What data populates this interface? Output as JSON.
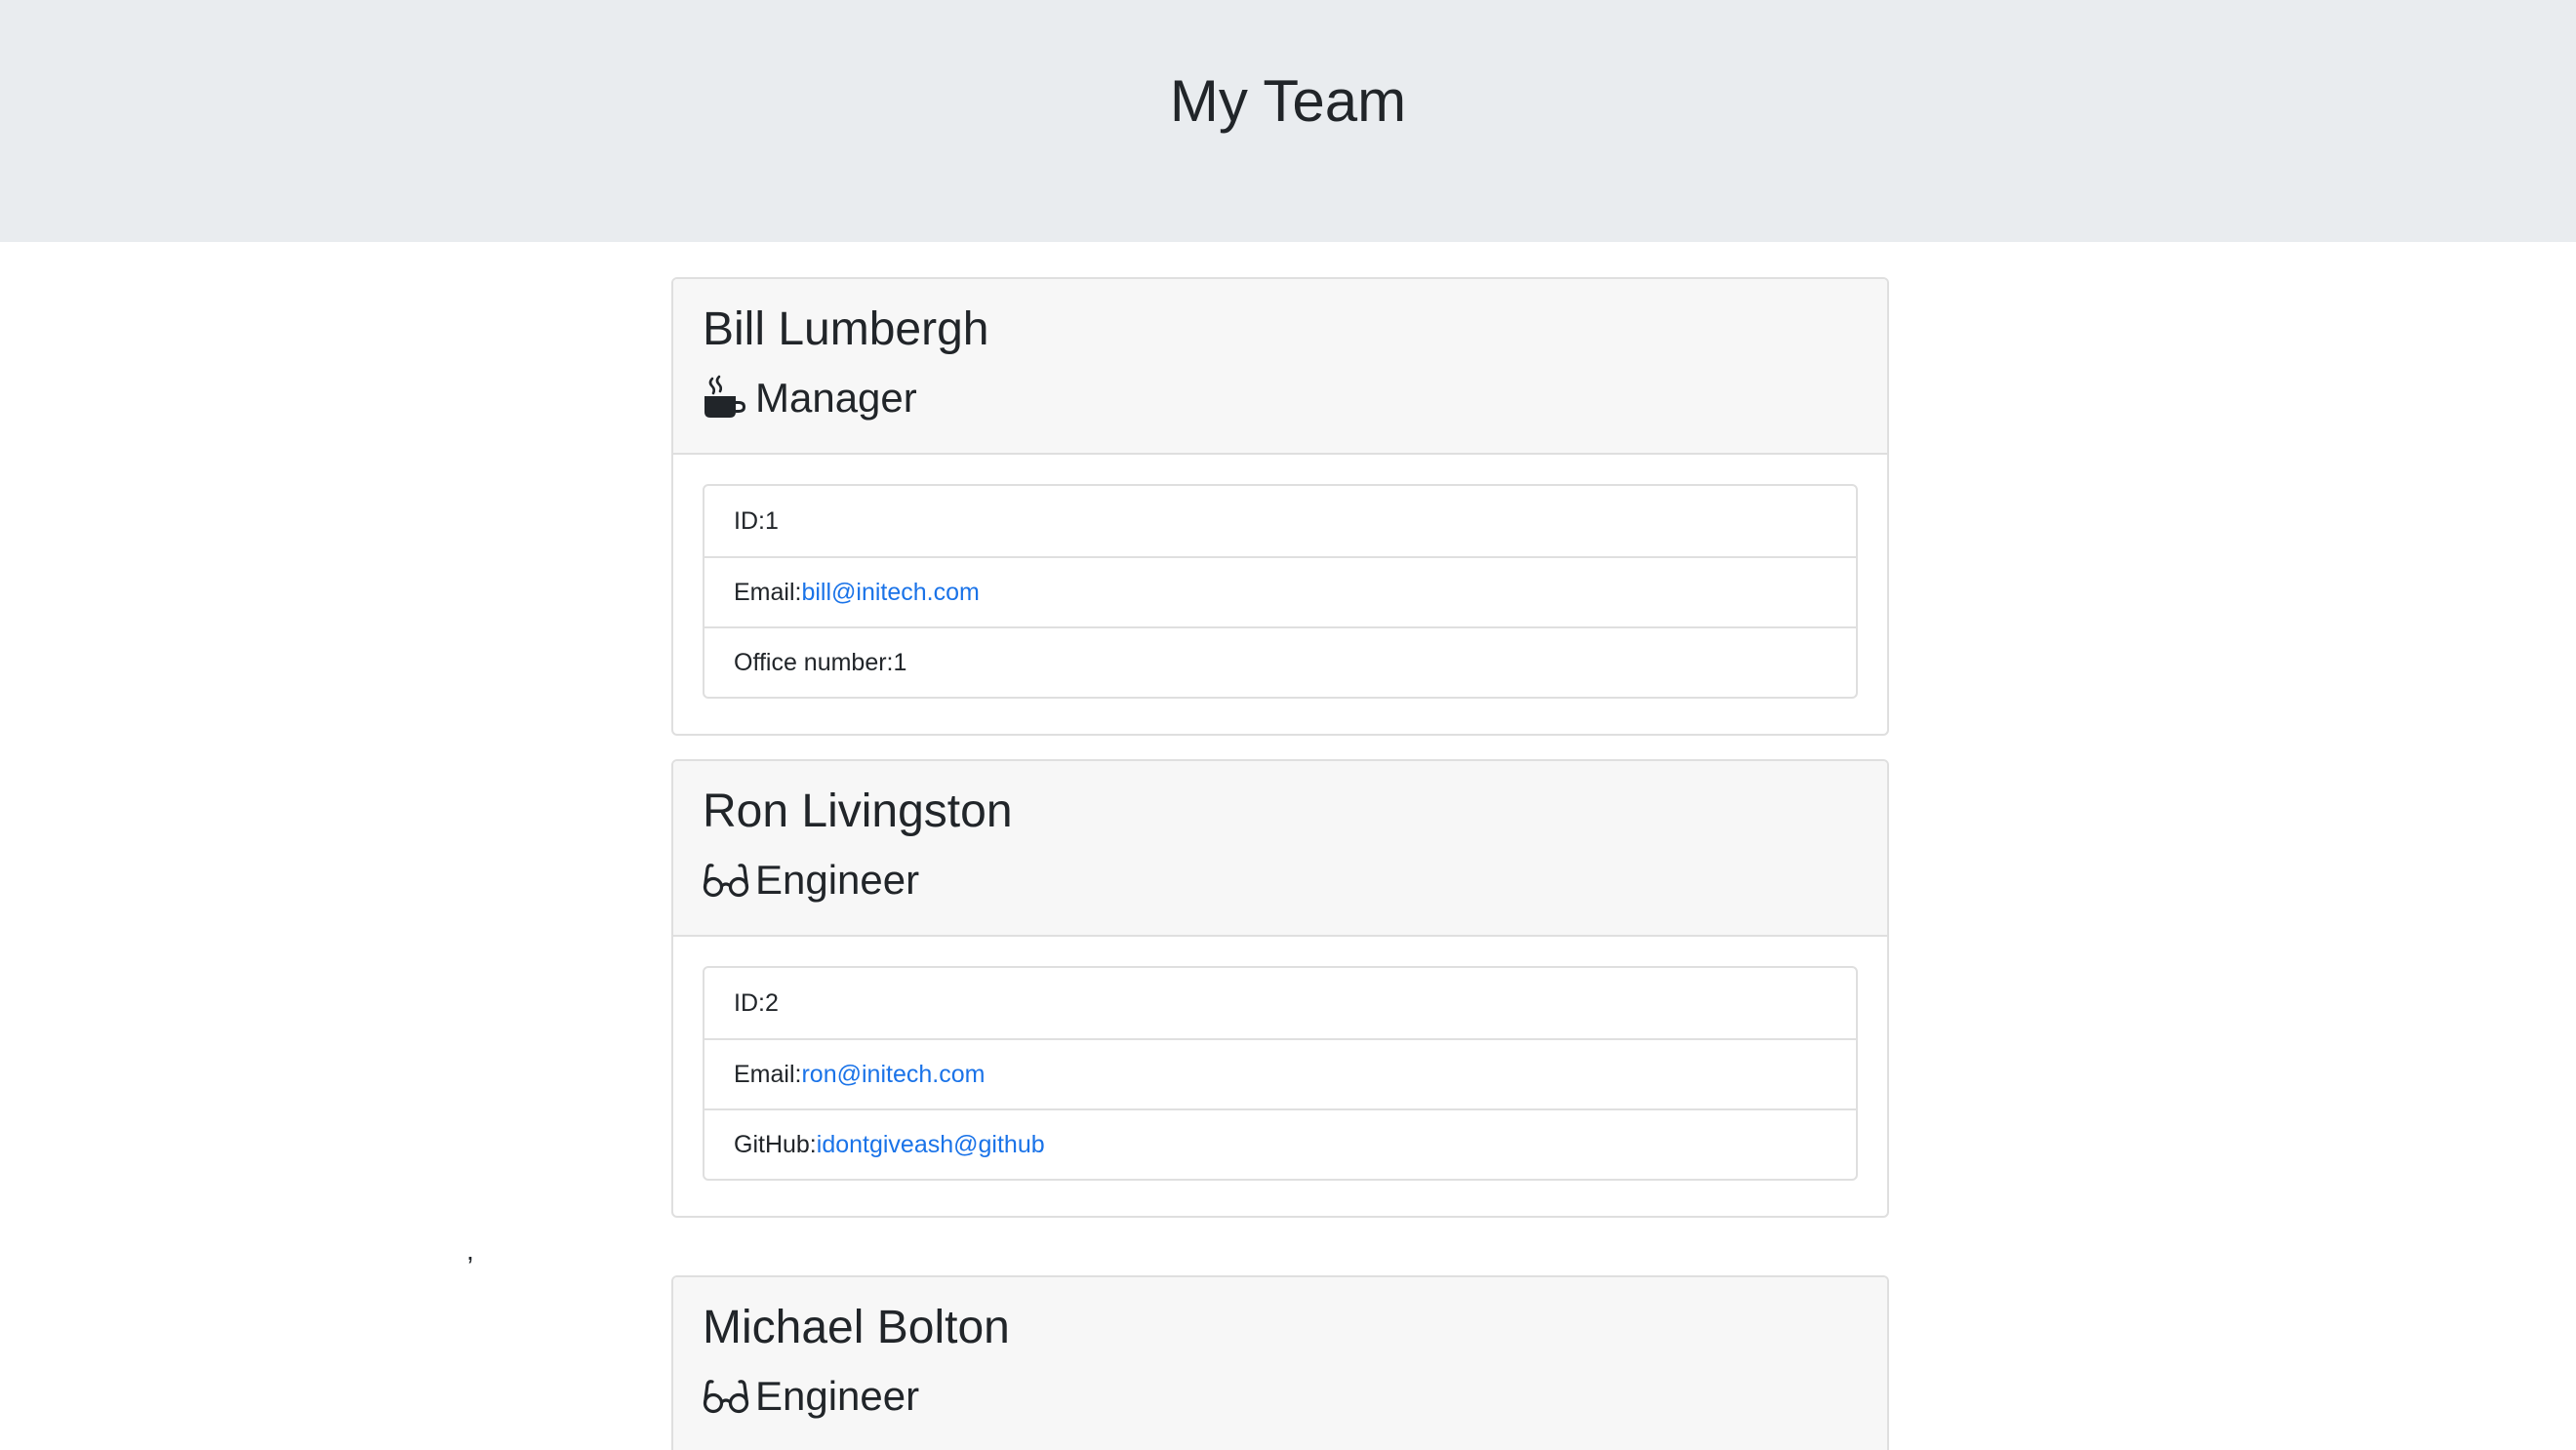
{
  "header": {
    "title": "My Team"
  },
  "stray_text": ",",
  "employees": [
    {
      "name": "Bill Lumbergh",
      "role": "Manager",
      "role_icon": "mug-hot-icon",
      "id_label": "ID: ",
      "id": "1",
      "email_label": "Email: ",
      "email": "bill@initech.com",
      "extra_label": "Office number: ",
      "extra_value": "1"
    },
    {
      "name": "Ron Livingston",
      "role": "Engineer",
      "role_icon": "glasses-icon",
      "id_label": "ID: ",
      "id": "2",
      "email_label": "Email: ",
      "email": "ron@initech.com",
      "extra_label": "GitHub: ",
      "extra_value": "idontgiveash@github"
    },
    {
      "name": "Michael Bolton",
      "role": "Engineer",
      "role_icon": "glasses-icon"
    }
  ],
  "colors": {
    "header_background": "#e9ecef",
    "card_header_background": "#f7f7f7",
    "link": "#1a73e8",
    "text": "#212529",
    "border": "#dfdfdf"
  }
}
